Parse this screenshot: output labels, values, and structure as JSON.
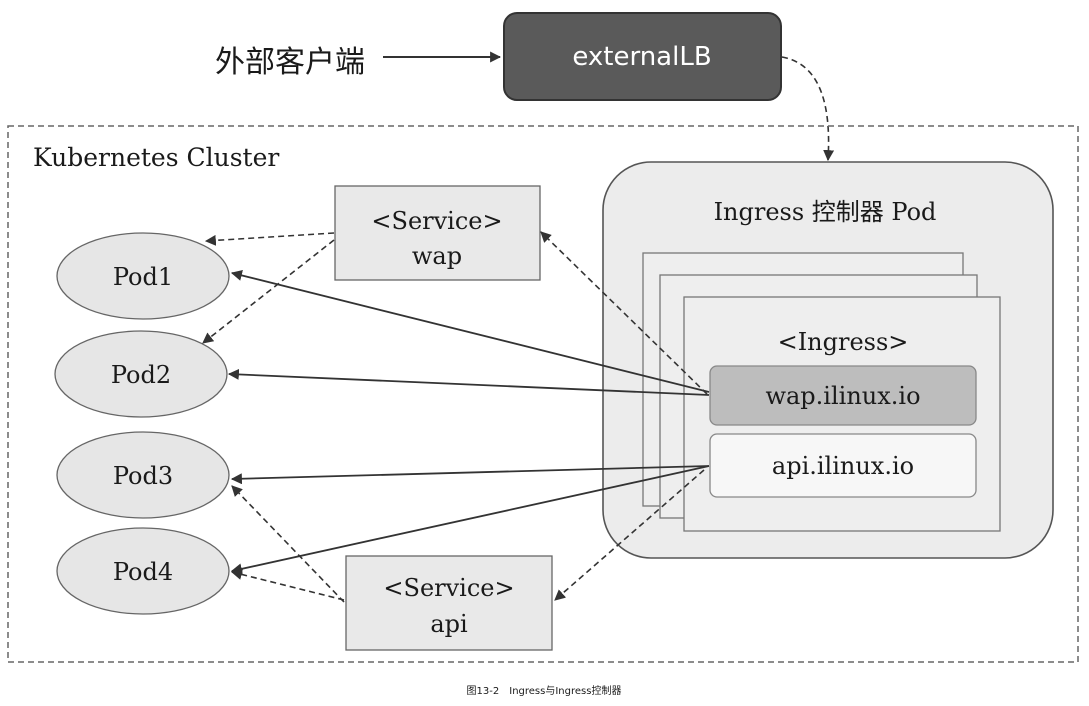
{
  "client_label": "外部客户端",
  "external_lb": "externalLB",
  "cluster_label": "Kubernetes Cluster",
  "ingress_pod_label": "Ingress 控制器 Pod",
  "ingress_label": "<Ingress>",
  "hosts": [
    "wap.ilinux.io",
    "api.ilinux.io"
  ],
  "services": [
    {
      "line1": "<Service>",
      "line2": "wap"
    },
    {
      "line1": "<Service>",
      "line2": "api"
    }
  ],
  "pods": [
    "Pod1",
    "Pod2",
    "Pod3",
    "Pod4"
  ],
  "caption": "图13-2　Ingress与Ingress控制器",
  "colors": {
    "external_lb_fill": "#5a5a5a",
    "service_fill": "#e9e9e9",
    "pod_fill": "#e6e6e6",
    "ingress_pod_fill": "#ececec",
    "wap_host_fill": "#bdbdbd",
    "api_host_fill": "#f7f7f7",
    "line": "#333333"
  }
}
